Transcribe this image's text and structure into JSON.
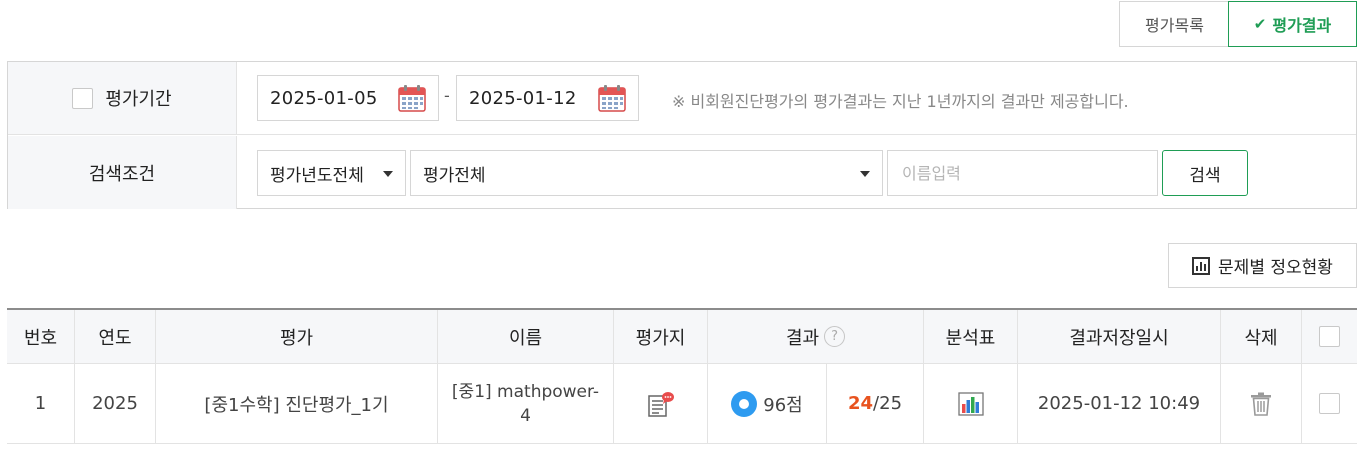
{
  "tabs": {
    "list_label": "평가목록",
    "result_label": "평가결과"
  },
  "period": {
    "label": "평가기간",
    "start_date": "2025-01-05",
    "end_date": "2025-01-12",
    "separator": "-",
    "notice": "※ 비회원진단평가의 평가결과는 지난 1년까지의 결과만 제공합니다."
  },
  "conditions": {
    "label": "검색조건",
    "year_select": "평가년도전체",
    "eval_select": "평가전체",
    "name_placeholder": "이름입력",
    "search_label": "검색"
  },
  "stats_button": "문제별 정오현황",
  "table": {
    "headers": {
      "no": "번호",
      "year": "연도",
      "eval": "평가",
      "name": "이름",
      "sheet": "평가지",
      "result": "결과",
      "result_help": "?",
      "analysis": "분석표",
      "saved_at": "결과저장일시",
      "delete": "삭제"
    },
    "rows": [
      {
        "no": "1",
        "year": "2025",
        "eval": "[중1수학] 진단평가_1기",
        "name": "[중1] mathpower-4",
        "score": "96점",
        "correct": "24",
        "total": "/25",
        "saved_at": "2025-01-12 10:49"
      }
    ]
  },
  "colors": {
    "accent": "#1f9d55",
    "radio": "#2e9bf0",
    "correct": "#e8531f"
  },
  "icons": [
    "check-icon",
    "calendar-icon",
    "caret-down-icon",
    "bar-chart-icon",
    "test-sheet-icon",
    "analysis-chart-icon",
    "trash-icon",
    "help-icon"
  ]
}
